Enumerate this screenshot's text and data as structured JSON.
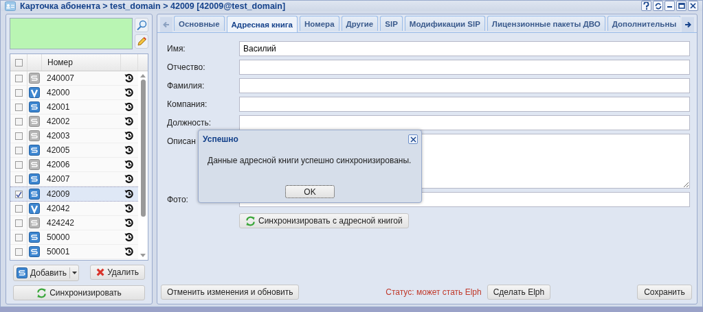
{
  "window": {
    "title": "Карточка абонента > test_domain > 42009 [42009@test_domain]"
  },
  "list": {
    "header": "Номер",
    "select_all_checked": false,
    "rows": [
      {
        "number": "240007",
        "kind": "s",
        "enabled": false,
        "checked": false,
        "selected": false
      },
      {
        "number": "42000",
        "kind": "v",
        "enabled": true,
        "checked": false,
        "selected": false
      },
      {
        "number": "42001",
        "kind": "s",
        "enabled": true,
        "checked": false,
        "selected": false
      },
      {
        "number": "42002",
        "kind": "s",
        "enabled": false,
        "checked": false,
        "selected": false
      },
      {
        "number": "42003",
        "kind": "s",
        "enabled": false,
        "checked": false,
        "selected": false
      },
      {
        "number": "42005",
        "kind": "s",
        "enabled": true,
        "checked": false,
        "selected": false
      },
      {
        "number": "42006",
        "kind": "s",
        "enabled": false,
        "checked": false,
        "selected": false
      },
      {
        "number": "42007",
        "kind": "s",
        "enabled": true,
        "checked": false,
        "selected": false
      },
      {
        "number": "42009",
        "kind": "s",
        "enabled": true,
        "checked": true,
        "selected": true
      },
      {
        "number": "42042",
        "kind": "v",
        "enabled": true,
        "checked": false,
        "selected": false
      },
      {
        "number": "424242",
        "kind": "s",
        "enabled": false,
        "checked": false,
        "selected": false
      },
      {
        "number": "50000",
        "kind": "s",
        "enabled": true,
        "checked": false,
        "selected": false
      },
      {
        "number": "50001",
        "kind": "s",
        "enabled": true,
        "checked": false,
        "selected": false
      }
    ],
    "add_button": "Добавить",
    "delete_button": "Удалить",
    "sync_button": "Синхронизировать"
  },
  "tabs": [
    {
      "label": "Основные",
      "selected": false
    },
    {
      "label": "Адресная книга",
      "selected": true
    },
    {
      "label": "Номера",
      "selected": false
    },
    {
      "label": "Другие",
      "selected": false
    },
    {
      "label": "SIP",
      "selected": false
    },
    {
      "label": "Модификации SIP",
      "selected": false
    },
    {
      "label": "Лицензионные пакеты ДВО",
      "selected": false
    },
    {
      "label": "Дополнительны",
      "selected": false
    }
  ],
  "form": {
    "fields": [
      {
        "label": "Имя:",
        "value": "Василий",
        "kind": "input"
      },
      {
        "label": "Отчество:",
        "kind": "input"
      },
      {
        "label": "Фамилия:",
        "kind": "input"
      },
      {
        "label": "Компания:",
        "kind": "input"
      },
      {
        "label": "Должность:",
        "kind": "input"
      },
      {
        "label": "Описан",
        "kind": "textarea"
      },
      {
        "label": "Фото:",
        "kind": "input"
      }
    ],
    "sync_button": "Синхронизировать с адресной книгой"
  },
  "footer": {
    "revert_button": "Отменить изменения и обновить",
    "status": "Статус: может стать Elph",
    "elph_button": "Сделать Elph",
    "save_button": "Сохранить"
  },
  "dialog": {
    "title": "Успешно",
    "message": "Данные адресной книги успешно синхронизированы.",
    "ok_button": "OK"
  }
}
